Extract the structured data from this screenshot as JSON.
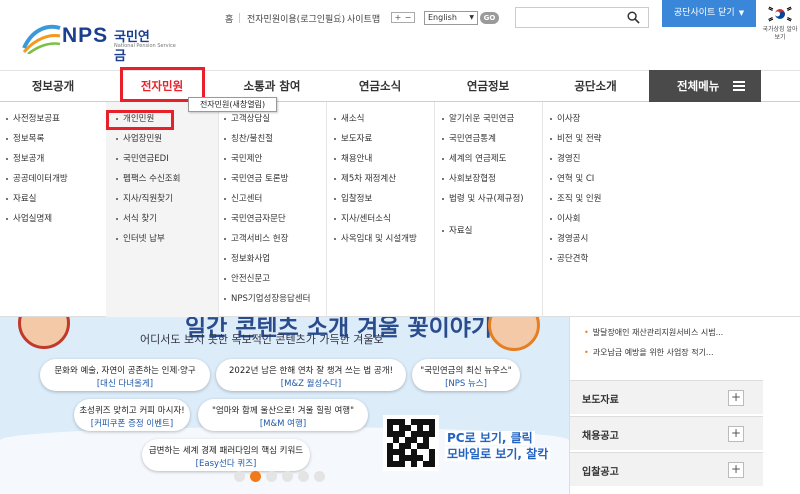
{
  "logo": {
    "text": "NPS",
    "kr": "국민연금",
    "sub": "National Pension Service"
  },
  "utility": {
    "home": "홈",
    "ecivil": "전자민원이용(로그인필요)",
    "sitemap": "사이트맵",
    "zoom_in": "+",
    "zoom_out": "−",
    "lang_selected": "English",
    "go": "GO"
  },
  "close_site": {
    "label": "공단사이트 닫기",
    "arrow": "▼"
  },
  "flag": {
    "label": "국가상징 알아보기"
  },
  "gnb": [
    {
      "label": "정보공개"
    },
    {
      "label": "전자민원"
    },
    {
      "label": "소통과 참여"
    },
    {
      "label": "연금소식"
    },
    {
      "label": "연금정보"
    },
    {
      "label": "공단소개"
    }
  ],
  "all_menu": {
    "label": "전체메뉴"
  },
  "tooltip": "전자민원(새창열림)",
  "dropdown": [
    [
      "사전정보공표",
      "정보목록",
      "정보공개",
      "공공데이터개방",
      "자료실",
      "사업실명제"
    ],
    [
      "개인민원",
      "사업장민원",
      "국민연금EDI",
      "펩팩스 수신조회",
      "지사/직원찾기",
      "서식 찾기",
      "인터넷 납부"
    ],
    [
      "고객상담실",
      "칭찬/불친절",
      "국민제안",
      "국민연금 토론방",
      "신고센터",
      "국민연금자문단",
      "고객서비스 헌장",
      "정보화사업",
      "안전신문고",
      "NPS기업성장응답센터"
    ],
    [
      "새소식",
      "보도자료",
      "채용안내",
      "제5차 재정계산",
      "입찰정보",
      "지사/센터소식",
      "사옥임대 및 시설개방"
    ],
    [
      "알기쉬운 국민연금",
      "국민연금통계",
      "세계의 연금제도",
      "사회보장협정",
      "법령 및 사규(제규정)",
      "자료실"
    ],
    [
      "이사장",
      "비전 및 전략",
      "경영진",
      "연혁 및 CI",
      "조직 및 인원",
      "이사회",
      "경영공시",
      "공단견학"
    ]
  ],
  "banner": {
    "title": "일간 콘텐츠 소개 겨울 꽃이야기",
    "subtitle": "어디서도 보지 못한 독보적인 콘텐츠가 가득한 겨울호",
    "cards": [
      {
        "line1": "문화와 예술, 자연이 공존하는 인제·양구",
        "line2": "[대신 다녀올게]"
      },
      {
        "line1": "2022년 남은 한해 연차 잘 챙겨 쓰는 법 공개!",
        "line2": "[M&Z 월성수다]"
      },
      {
        "line1": "\"국민연금의 최신 뉴우스\"",
        "line2": "[NPS 뉴스]"
      },
      {
        "line1": "초성퀴즈 맞히고 커피 마시자!",
        "line2": "[커피쿠폰 증정 이벤트]"
      },
      {
        "line1": "\"엄마와 함께 울산으로! 겨울 힐링 여행\"",
        "line2": "[M&M 여행]"
      },
      {
        "line1": "급변하는 세계 경제 패러다임의 핵심 키워드",
        "line2": "[Easy선다 퀴즈]"
      }
    ],
    "qr_text1": "PC로 보기, 클릭",
    "qr_text2": "모바일로 보기, 찰칵",
    "slide_count": 6,
    "active_slide": 2
  },
  "right_panel": {
    "notices": [
      "발달장애인 재산관리지원서비스 시범...",
      "과오납금 예방을 위한 사업장 적기..."
    ],
    "sections": [
      "보도자료",
      "채용공고",
      "입찰공고"
    ],
    "plus": "+"
  },
  "colors": {
    "brand": "#1b3f8f",
    "accent": "#3a87d9",
    "highlight": "#e8202a",
    "orange": "#f07a1a"
  }
}
